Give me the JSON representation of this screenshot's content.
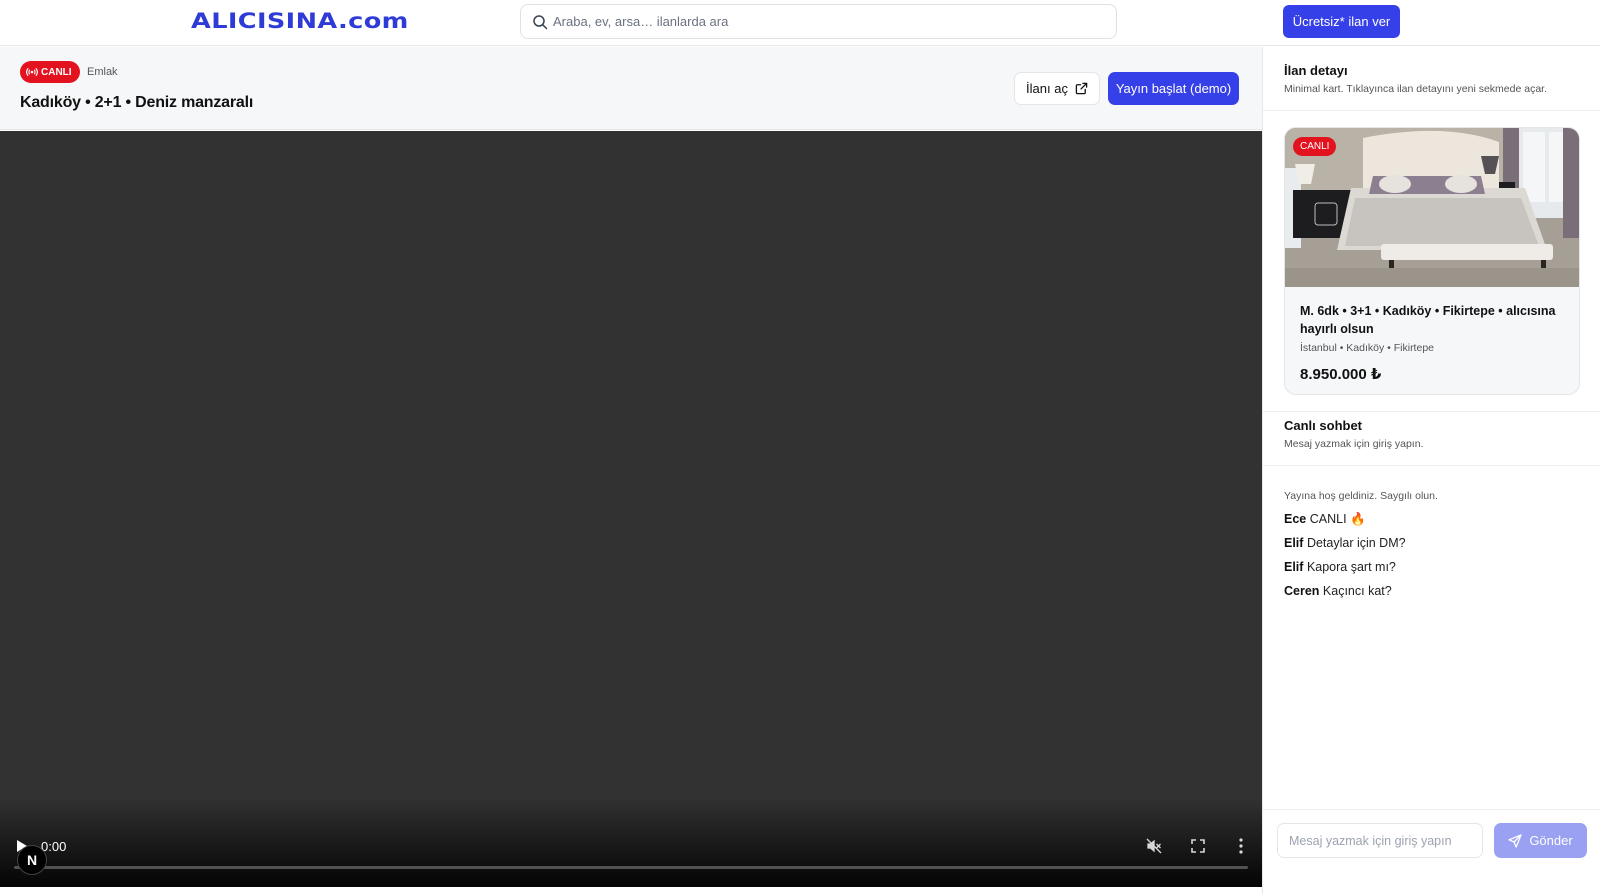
{
  "header": {
    "logo": "ALICISINA.com",
    "search_placeholder": "Araba, ev, arsa… ilanlarda ara",
    "cta_label": "Ücretsiz* ilan ver"
  },
  "stream": {
    "live_badge": "CANLI",
    "category": "Emlak",
    "title": "Kadıköy • 2+1 • Deniz manzaralı",
    "open_listing_label": "İlanı aç",
    "start_stream_label": "Yayın başlat (demo)"
  },
  "video": {
    "time": "0:00",
    "progress": 0,
    "overlay_badge": "N"
  },
  "listing_panel": {
    "title": "İlan detayı",
    "subtitle": "Minimal kart. Tıklayınca ilan detayını yeni sekmede açar.",
    "card": {
      "badge": "CANLI",
      "title": "M. 6dk • 3+1 • Kadıköy • Fikirtepe • alıcısına hayırlı olsun",
      "location": "İstanbul • Kadıköy • Fikirtepe",
      "price": "8.950.000 ₺"
    }
  },
  "chat": {
    "title": "Canlı sohbet",
    "subtitle": "Mesaj yazmak için giriş yapın.",
    "system_message": "Yayına hoş geldiniz. Saygılı olun.",
    "messages": [
      {
        "user": "Ece",
        "text": "CANLI 🔥"
      },
      {
        "user": "Elif",
        "text": "Detaylar için DM?"
      },
      {
        "user": "Elif",
        "text": "Kapora şart mı?"
      },
      {
        "user": "Ceren",
        "text": "Kaçıncı kat?"
      }
    ],
    "input_placeholder": "Mesaj yazmak için giriş yapın",
    "send_label": "Gönder"
  },
  "colors": {
    "brand": "#2f3bd6",
    "primary_button": "#3640e8",
    "live_red": "#e3121f",
    "video_bg": "#323232",
    "send_disabled": "#9aa0f2"
  },
  "icons": {
    "search": "search-icon",
    "live": "broadcast-icon",
    "open": "external-link-icon",
    "play": "play-icon",
    "mute": "muted-speaker-icon",
    "fullscreen": "fullscreen-icon",
    "more": "vertical-dots-icon",
    "send": "send-icon"
  }
}
